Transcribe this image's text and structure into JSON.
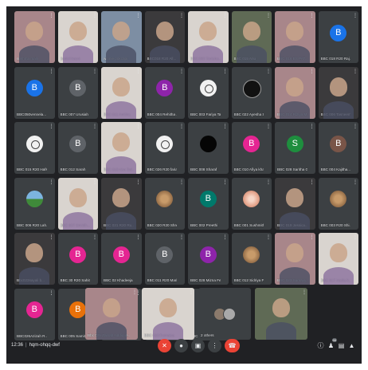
{
  "participants": [
    {
      "name": "sushma malli",
      "kind": "video",
      "tone": "pink"
    },
    {
      "name": "Sadaf Nazni",
      "kind": "video",
      "tone": "light"
    },
    {
      "name": "winnie pokcapi",
      "kind": "video",
      "tone": "blue"
    },
    {
      "name": "BBC018 R20 All...",
      "kind": "video",
      "tone": "dark"
    },
    {
      "name": "BBC 035 Tanisha...",
      "kind": "video",
      "tone": "light"
    },
    {
      "name": "BBC 015 Anu",
      "kind": "video",
      "tone": "green"
    },
    {
      "name": "BBC 016 ES PAT...",
      "kind": "video",
      "tone": "pink"
    },
    {
      "name": "BBC 018 R20 Raj...",
      "kind": "avatar",
      "letter": "B",
      "color": "#1a73e8"
    },
    {
      "name": "BBC050vennela...",
      "kind": "avatar",
      "letter": "B",
      "color": "#1a73e8"
    },
    {
      "name": "BBC 007 Urusiah",
      "kind": "avatar",
      "letter": "B",
      "color": "#5f6368"
    },
    {
      "name": "BBC 011 Amitha",
      "kind": "video",
      "tone": "light"
    },
    {
      "name": "BBC 004 Rehitha ...",
      "kind": "avatar",
      "letter": "B",
      "color": "#8e24aa"
    },
    {
      "name": "BBC 003 Fariya Ta...",
      "kind": "photo",
      "style": "white"
    },
    {
      "name": "BBC 022 Ayesha S...",
      "kind": "photo",
      "style": "blackcard"
    },
    {
      "name": "BBC 014 Riziya M...",
      "kind": "video",
      "tone": "pink"
    },
    {
      "name": "BBC 006 Tasneem...",
      "kind": "video",
      "tone": "dark"
    },
    {
      "name": "BBC 015 R20 Hafs...",
      "kind": "photo",
      "style": "white"
    },
    {
      "name": "BBC 012 Sarah",
      "kind": "avatar",
      "letter": "B",
      "color": "#5f6368"
    },
    {
      "name": "BBC 016 viya Bat...",
      "kind": "video",
      "tone": "light"
    },
    {
      "name": "BBC 026 R20 faria...",
      "kind": "photo",
      "style": "white"
    },
    {
      "name": "BBC 008 Sharaf",
      "kind": "photo",
      "style": "black"
    },
    {
      "name": "BBC 010 Afiya kha...",
      "kind": "avatar",
      "letter": "B",
      "color": "#e52592"
    },
    {
      "name": "BBC 028 Saritha G...",
      "kind": "avatar",
      "letter": "S",
      "color": "#1e8e3e"
    },
    {
      "name": "BBC 004 Kajitha...",
      "kind": "avatar",
      "letter": "B",
      "color": "#795548"
    },
    {
      "name": "BBC 006 R20 Lah...",
      "kind": "photo",
      "style": "scenery"
    },
    {
      "name": "BBC 007 Srividh...",
      "kind": "video",
      "tone": "light"
    },
    {
      "name": "BBC 031 R20 Ru...",
      "kind": "video",
      "tone": "dark"
    },
    {
      "name": "BBC 020 R20 Shre...",
      "kind": "photo",
      "style": "brown"
    },
    {
      "name": "BBC 002 Preethi",
      "kind": "avatar",
      "letter": "B",
      "color": "#00796b"
    },
    {
      "name": "BBC 001 Sushmith...",
      "kind": "photo",
      "style": "floral"
    },
    {
      "name": "BBC 019 Jessica...",
      "kind": "video",
      "tone": "dark"
    },
    {
      "name": "BBC 003 R20 Shi...",
      "kind": "photo",
      "style": "brown"
    },
    {
      "name": "Bbc023sayali b...",
      "kind": "video",
      "tone": "dark"
    },
    {
      "name": "BBC 30 R20 Sahiti...",
      "kind": "avatar",
      "letter": "B",
      "color": "#e52592"
    },
    {
      "name": "BBC 02 Khadeeja",
      "kind": "avatar",
      "letter": "B",
      "color": "#e52592"
    },
    {
      "name": "BBC 011 R20 Maria...",
      "kind": "avatar",
      "letter": "B",
      "color": "#5f6368"
    },
    {
      "name": "BBC 028 Mizna Fe...",
      "kind": "avatar",
      "letter": "B",
      "color": "#8e24aa"
    },
    {
      "name": "BBC 012 Sidriya F...",
      "kind": "photo",
      "style": "brown"
    },
    {
      "name": "BBC 023 Sumayy...",
      "kind": "video",
      "tone": "pink"
    },
    {
      "name": "BBC 017 Nadia k...",
      "kind": "video",
      "tone": "light"
    },
    {
      "name": "BBC026Azizah R...",
      "kind": "avatar",
      "letter": "B",
      "color": "#e52592"
    },
    {
      "name": "BBC 005 Samitha...",
      "kind": "avatar",
      "letter": "B",
      "color": "#e8710a"
    },
    {
      "name": "BBC 016 Karrebola...",
      "kind": "avatar",
      "letter": "B",
      "color": "#e52592"
    },
    {
      "name": "BBC 009 Ayesha",
      "kind": "photo",
      "style": "white"
    },
    {
      "name": "BBC 024 Sankeert...",
      "kind": "photo",
      "style": "floral"
    }
  ],
  "bottom_tiles": [
    {
      "name": "Bbc 025 Zainab siddique...",
      "kind": "video",
      "tone": "pink"
    },
    {
      "name": "BBC 020 Rumaisa",
      "kind": "video",
      "tone": "light"
    },
    {
      "name": "2 others",
      "kind": "others"
    },
    {
      "name": "",
      "kind": "video",
      "tone": "green"
    }
  ],
  "meeting": {
    "time": "12:36",
    "code": "hqm-ohqq-dwf"
  },
  "people_count": "66",
  "colors": {
    "background": "#202124",
    "tile": "#3c4043",
    "danger": "#ea4335"
  },
  "icons": {
    "mic": "mic-off-icon",
    "camera": "camera-icon",
    "present": "present-icon",
    "more": "more-vert-icon",
    "end": "end-call-icon",
    "info": "info-icon",
    "people": "people-icon",
    "chat": "chat-icon",
    "activities": "activities-icon"
  }
}
